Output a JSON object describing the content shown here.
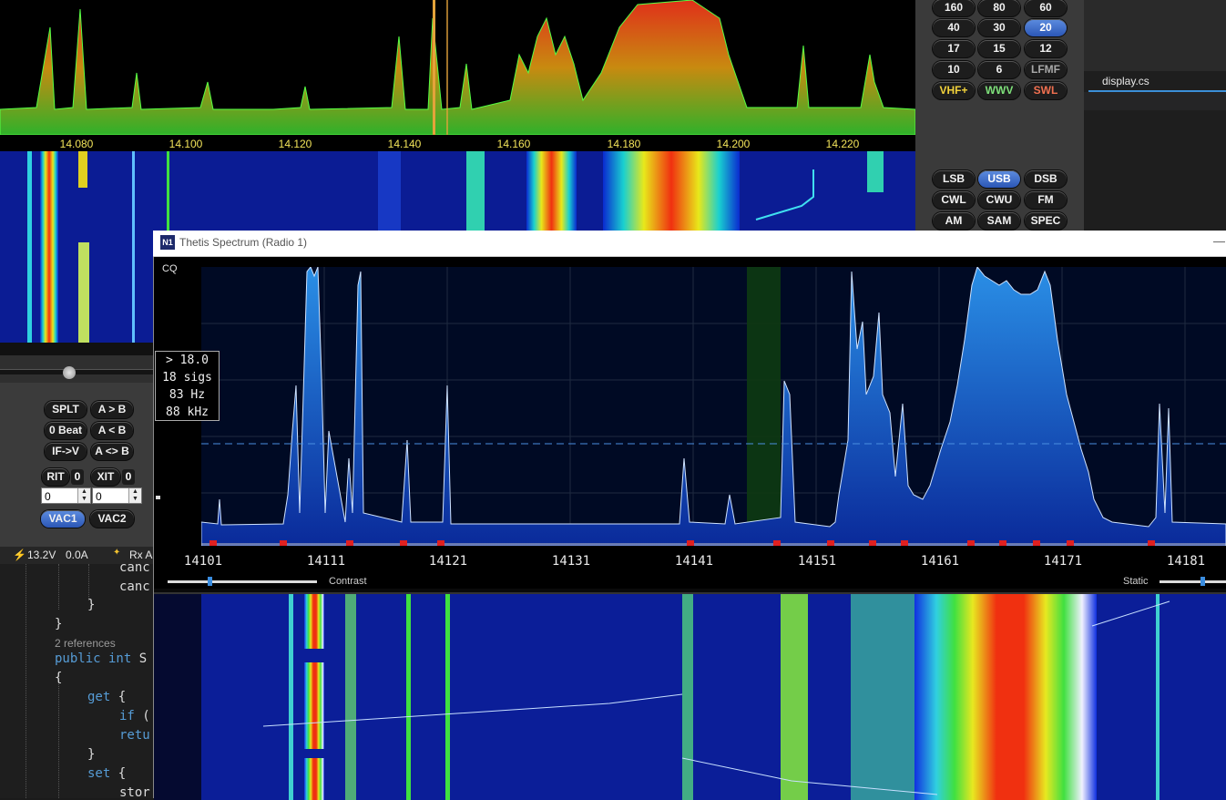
{
  "top_scale": {
    "ticks": [
      "14.080",
      "14.100",
      "14.120",
      "14.140",
      "14.160",
      "14.180",
      "14.200",
      "14.220"
    ]
  },
  "band_panel": {
    "bands": [
      "160",
      "80",
      "60",
      "40",
      "30",
      "20",
      "17",
      "15",
      "12",
      "10",
      "6",
      "LFMF",
      "VHF+",
      "WWV",
      "SWL"
    ],
    "active_band": "20",
    "modes": [
      "LSB",
      "USB",
      "DSB",
      "CWL",
      "CWU",
      "FM",
      "AM",
      "SAM",
      "SPEC"
    ],
    "active_mode": "USB"
  },
  "editor_tab": {
    "label": "display.cs"
  },
  "left_panel": {
    "splt": "SPLT",
    "a_to_b": "A > B",
    "zero_beat": "0 Beat",
    "a_from_b": "A < B",
    "if_to_v": "IF->V",
    "a_swap_b": "A <> B",
    "rit": "RIT",
    "rit_val": "0",
    "xit": "XIT",
    "xit_val": "0",
    "rit_spin": "0",
    "xit_spin": "0",
    "vac1": "VAC1",
    "vac2": "VAC2"
  },
  "status_bar": {
    "voltage": "13.2V",
    "current": "0.0A",
    "rx": "Rx A"
  },
  "code": {
    "line1": "canc",
    "line2": "canc",
    "line3": "}",
    "line4": "}",
    "refs": "2 references",
    "line6_kw": "public int",
    "line6_rest": " S",
    "line7": "{",
    "line8_kw": "get",
    "line8_rest": " {",
    "line9_kw": "if",
    "line9_rest": " (",
    "line10": "retu",
    "line11": "}",
    "line12_kw": "set",
    "line12_rest": " {",
    "line13": "stor"
  },
  "window": {
    "title": "Thetis Spectrum (Radio 1)",
    "icon_text": "N1",
    "minimize": "—",
    "cq": "CQ"
  },
  "stats": {
    "threshold": "> 18.0",
    "sigs": "18 sigs",
    "hz": "83 Hz",
    "khz": "88 kHz"
  },
  "freq_axis": {
    "ticks": [
      "14101",
      "14111",
      "14121",
      "14131",
      "14141",
      "14151",
      "14161",
      "14171",
      "14181"
    ]
  },
  "sliders": {
    "contrast": "Contrast",
    "contrast_level": 0.28,
    "static": "Static",
    "static_level": 0.65
  }
}
